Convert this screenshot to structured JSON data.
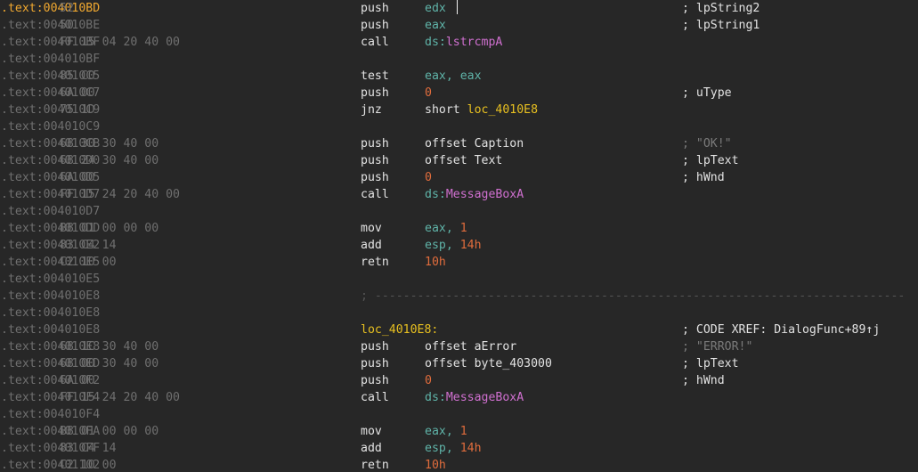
{
  "colors": {
    "background": "#272727",
    "address": "#6f6f6f",
    "current_address": "#f0a830",
    "mnemonic": "#e2e2e2",
    "register": "#5fb3a8",
    "number": "#e06c3c",
    "label": "#e8c020",
    "api": "#d070d0",
    "comment_dim": "#7a7a7a"
  },
  "lines": [
    {
      "addr": ".text:004010BD",
      "bytes": "52",
      "mnem": "push",
      "ops": [
        {
          "t": "edx",
          "c": "reg"
        }
      ],
      "cmt": "; lpString2",
      "current": true
    },
    {
      "addr": ".text:004010BE",
      "bytes": "50",
      "mnem": "push",
      "ops": [
        {
          "t": "eax",
          "c": "reg"
        }
      ],
      "cmt": "; lpString1"
    },
    {
      "addr": ".text:004010BF",
      "bytes": "FF 15 04 20 40 00",
      "mnem": "call",
      "ops": [
        {
          "t": "ds:",
          "c": "reg"
        },
        {
          "t": "lstrcmpA",
          "c": "api"
        }
      ]
    },
    {
      "addr": ".text:004010BF"
    },
    {
      "addr": ".text:004010C5",
      "bytes": "85 C0",
      "mnem": "test",
      "ops": [
        {
          "t": "eax, eax",
          "c": "reg"
        }
      ]
    },
    {
      "addr": ".text:004010C7",
      "bytes": "6A 00",
      "mnem": "push",
      "ops": [
        {
          "t": "0",
          "c": "num"
        }
      ],
      "cmt": "; uType"
    },
    {
      "addr": ".text:004010C9",
      "bytes": "75 1D",
      "mnem": "jnz",
      "ops": [
        {
          "t": "short ",
          "c": "txt"
        },
        {
          "t": "loc_4010E8",
          "c": "sym"
        }
      ]
    },
    {
      "addr": ".text:004010C9"
    },
    {
      "addr": ".text:004010CB",
      "bytes": "68 30 30 40 00",
      "mnem": "push",
      "ops": [
        {
          "t": "offset ",
          "c": "txt"
        },
        {
          "t": "Caption",
          "c": "txt"
        }
      ],
      "cmt": "; \"OK!\"",
      "cmt_dim": true
    },
    {
      "addr": ".text:004010D0",
      "bytes": "68 24 30 40 00",
      "mnem": "push",
      "ops": [
        {
          "t": "offset ",
          "c": "txt"
        },
        {
          "t": "Text",
          "c": "txt"
        }
      ],
      "cmt": "; lpText"
    },
    {
      "addr": ".text:004010D5",
      "bytes": "6A 00",
      "mnem": "push",
      "ops": [
        {
          "t": "0",
          "c": "num"
        }
      ],
      "cmt": "; hWnd"
    },
    {
      "addr": ".text:004010D7",
      "bytes": "FF 15 24 20 40 00",
      "mnem": "call",
      "ops": [
        {
          "t": "ds:",
          "c": "reg"
        },
        {
          "t": "MessageBoxA",
          "c": "api"
        }
      ]
    },
    {
      "addr": ".text:004010D7"
    },
    {
      "addr": ".text:004010DD",
      "bytes": "B8 01 00 00 00",
      "mnem": "mov",
      "ops": [
        {
          "t": "eax, ",
          "c": "reg"
        },
        {
          "t": "1",
          "c": "num"
        }
      ]
    },
    {
      "addr": ".text:004010E2",
      "bytes": "83 C4 14",
      "mnem": "add",
      "ops": [
        {
          "t": "esp, ",
          "c": "reg"
        },
        {
          "t": "14h",
          "c": "num"
        }
      ]
    },
    {
      "addr": ".text:004010E5",
      "bytes": "C2 10 00",
      "mnem": "retn",
      "ops": [
        {
          "t": "10h",
          "c": "num"
        }
      ]
    },
    {
      "addr": ".text:004010E5"
    },
    {
      "addr": ".text:004010E8",
      "sep": "; ---------------------------------------------------------------------------"
    },
    {
      "addr": ".text:004010E8"
    },
    {
      "addr": ".text:004010E8",
      "label": "loc_4010E8:",
      "cmt": "; CODE XREF: DialogFunc+89↑j"
    },
    {
      "addr": ".text:004010E8",
      "bytes": "68 1C 30 40 00",
      "mnem": "push",
      "ops": [
        {
          "t": "offset ",
          "c": "txt"
        },
        {
          "t": "aError",
          "c": "txt"
        }
      ],
      "cmt": "; \"ERROR!\"",
      "cmt_dim": true
    },
    {
      "addr": ".text:004010ED",
      "bytes": "68 00 30 40 00",
      "mnem": "push",
      "ops": [
        {
          "t": "offset ",
          "c": "txt"
        },
        {
          "t": "byte_403000",
          "c": "txt"
        }
      ],
      "cmt": "; lpText"
    },
    {
      "addr": ".text:004010F2",
      "bytes": "6A 00",
      "mnem": "push",
      "ops": [
        {
          "t": "0",
          "c": "num"
        }
      ],
      "cmt": "; hWnd"
    },
    {
      "addr": ".text:004010F4",
      "bytes": "FF 15 24 20 40 00",
      "mnem": "call",
      "ops": [
        {
          "t": "ds:",
          "c": "reg"
        },
        {
          "t": "MessageBoxA",
          "c": "api"
        }
      ]
    },
    {
      "addr": ".text:004010F4"
    },
    {
      "addr": ".text:004010FA",
      "bytes": "B8 01 00 00 00",
      "mnem": "mov",
      "ops": [
        {
          "t": "eax, ",
          "c": "reg"
        },
        {
          "t": "1",
          "c": "num"
        }
      ]
    },
    {
      "addr": ".text:004010FF",
      "bytes": "83 C4 14",
      "mnem": "add",
      "ops": [
        {
          "t": "esp, ",
          "c": "reg"
        },
        {
          "t": "14h",
          "c": "num"
        }
      ]
    },
    {
      "addr": ".text:00401102",
      "bytes": "C2 10 00",
      "mnem": "retn",
      "ops": [
        {
          "t": "10h",
          "c": "num"
        }
      ]
    }
  ]
}
